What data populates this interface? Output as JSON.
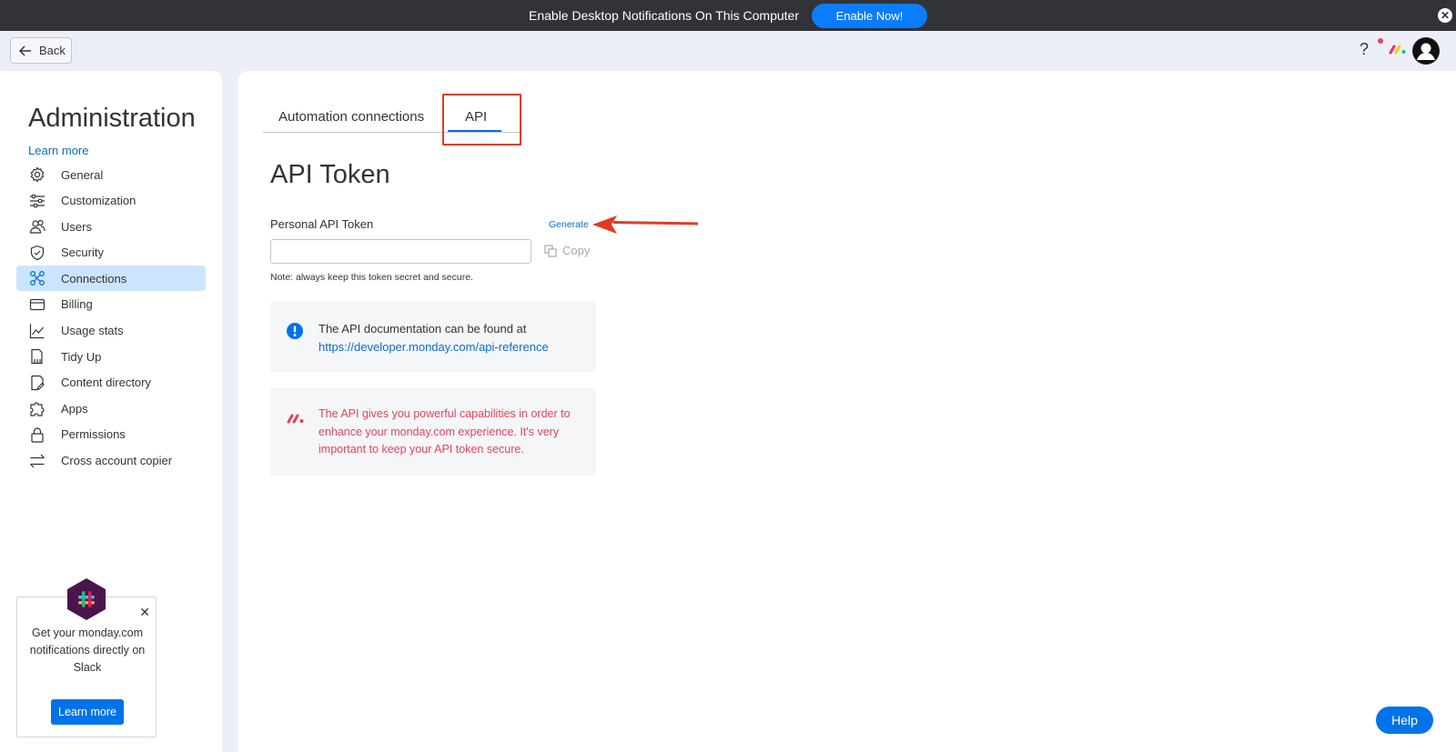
{
  "banner": {
    "text": "Enable Desktop Notifications On This Computer",
    "button_label": "Enable Now!",
    "close_glyph": "✕"
  },
  "header": {
    "back_label": "Back",
    "help_glyph": "?"
  },
  "sidebar": {
    "title": "Administration",
    "learn_more": "Learn more",
    "items": [
      {
        "label": "General",
        "icon": "gear-icon",
        "active": false
      },
      {
        "label": "Customization",
        "icon": "sliders-icon",
        "active": false
      },
      {
        "label": "Users",
        "icon": "users-icon",
        "active": false
      },
      {
        "label": "Security",
        "icon": "shield-icon",
        "active": false
      },
      {
        "label": "Connections",
        "icon": "connections-icon",
        "active": true
      },
      {
        "label": "Billing",
        "icon": "credit-card-icon",
        "active": false
      },
      {
        "label": "Usage stats",
        "icon": "chart-icon",
        "active": false
      },
      {
        "label": "Tidy Up",
        "icon": "broom-icon",
        "active": false
      },
      {
        "label": "Content directory",
        "icon": "document-icon",
        "active": false
      },
      {
        "label": "Apps",
        "icon": "puzzle-icon",
        "active": false
      },
      {
        "label": "Permissions",
        "icon": "lock-icon",
        "active": false
      },
      {
        "label": "Cross account copier",
        "icon": "swap-arrows-icon",
        "active": false
      }
    ]
  },
  "slack_promo": {
    "text": "Get your monday.com notifications directly on Slack",
    "button_label": "Learn more",
    "close_glyph": "✕"
  },
  "tabs": {
    "automation": "Automation connections",
    "api": "API",
    "active": "API"
  },
  "api": {
    "title": "API Token",
    "token_label": "Personal API Token",
    "generate_label": "Generate",
    "token_value": "",
    "copy_label": "Copy",
    "note": "Note: always keep this token secret and secure.",
    "doc_text": "The API documentation can be found at",
    "doc_link": "https://developer.monday.com/api-reference",
    "warning_text": "The API gives you powerful capabilities in order to enhance your monday.com experience. It's very important to keep your API token secure."
  },
  "help_button": "Help",
  "colors": {
    "accent": "#0073ea",
    "link": "#0a6cd0",
    "warning_text": "#e2445c",
    "annotation": "#e03c25",
    "active_nav": "#cce5ff"
  }
}
